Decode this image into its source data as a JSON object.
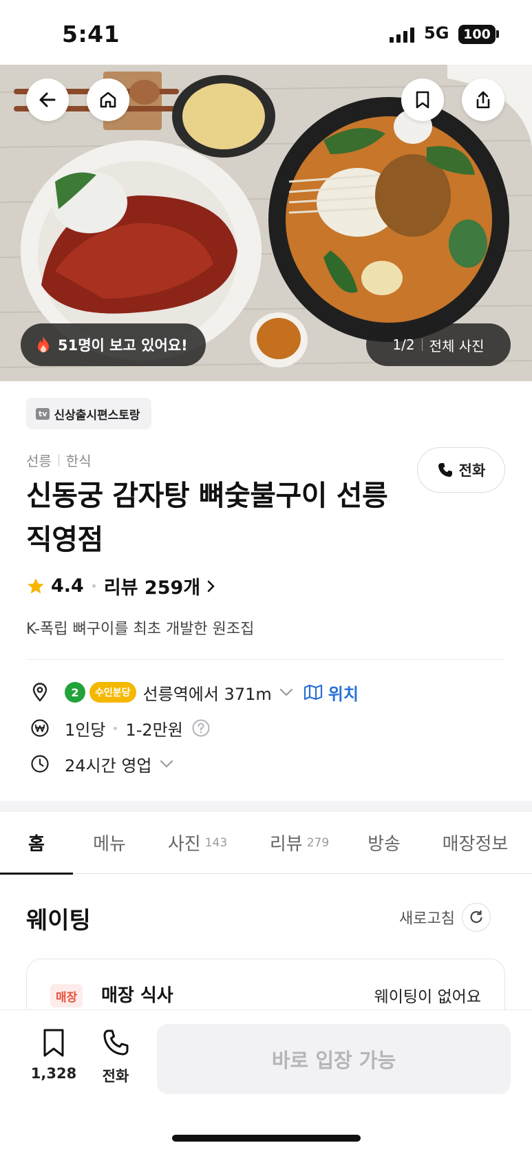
{
  "status_bar": {
    "time": "5:41",
    "network": "5G",
    "battery": "100"
  },
  "hero": {
    "viewers_text": "51명이 보고 있어요!",
    "photo_index": "1/2",
    "all_photos_label": "전체 사진"
  },
  "restaurant": {
    "tv_badge": "신상출시편스토랑",
    "area": "선릉",
    "cuisine": "한식",
    "name": "신동궁 감자탕 뼈숯불구이 선릉직영점",
    "rating": "4.4",
    "reviews_label": "리뷰 259개",
    "description": "K-폭립 뼈구이를 최초 개발한 원조집",
    "call_label": "전화"
  },
  "details": {
    "subway_line": "2",
    "subway_line2": "수인분당",
    "distance_text": "선릉역에서 371m",
    "map_label": "위치",
    "price_prefix": "1인당",
    "price_range": "1-2만원",
    "hours": "24시간 영업"
  },
  "tabs": [
    {
      "label": "홈",
      "count": ""
    },
    {
      "label": "메뉴",
      "count": ""
    },
    {
      "label": "사진",
      "count": "143"
    },
    {
      "label": "리뷰",
      "count": "279"
    },
    {
      "label": "방송",
      "count": ""
    },
    {
      "label": "매장정보",
      "count": ""
    }
  ],
  "waiting": {
    "title": "웨이팅",
    "refresh_label": "새로고침",
    "card_tag": "매장",
    "card_label": "매장 식사",
    "card_status": "웨이팅이 없어요"
  },
  "bottom_bar": {
    "bookmark_count": "1,328",
    "call_label": "전화",
    "enter_label": "바로 입장 가능"
  },
  "colors": {
    "line2_green": "#22a33a",
    "suin_bundang_yellow": "#f5b800",
    "map_link_blue": "#2a6fd6",
    "star_yellow": "#f7b500",
    "tag_red": "#e8523f"
  }
}
